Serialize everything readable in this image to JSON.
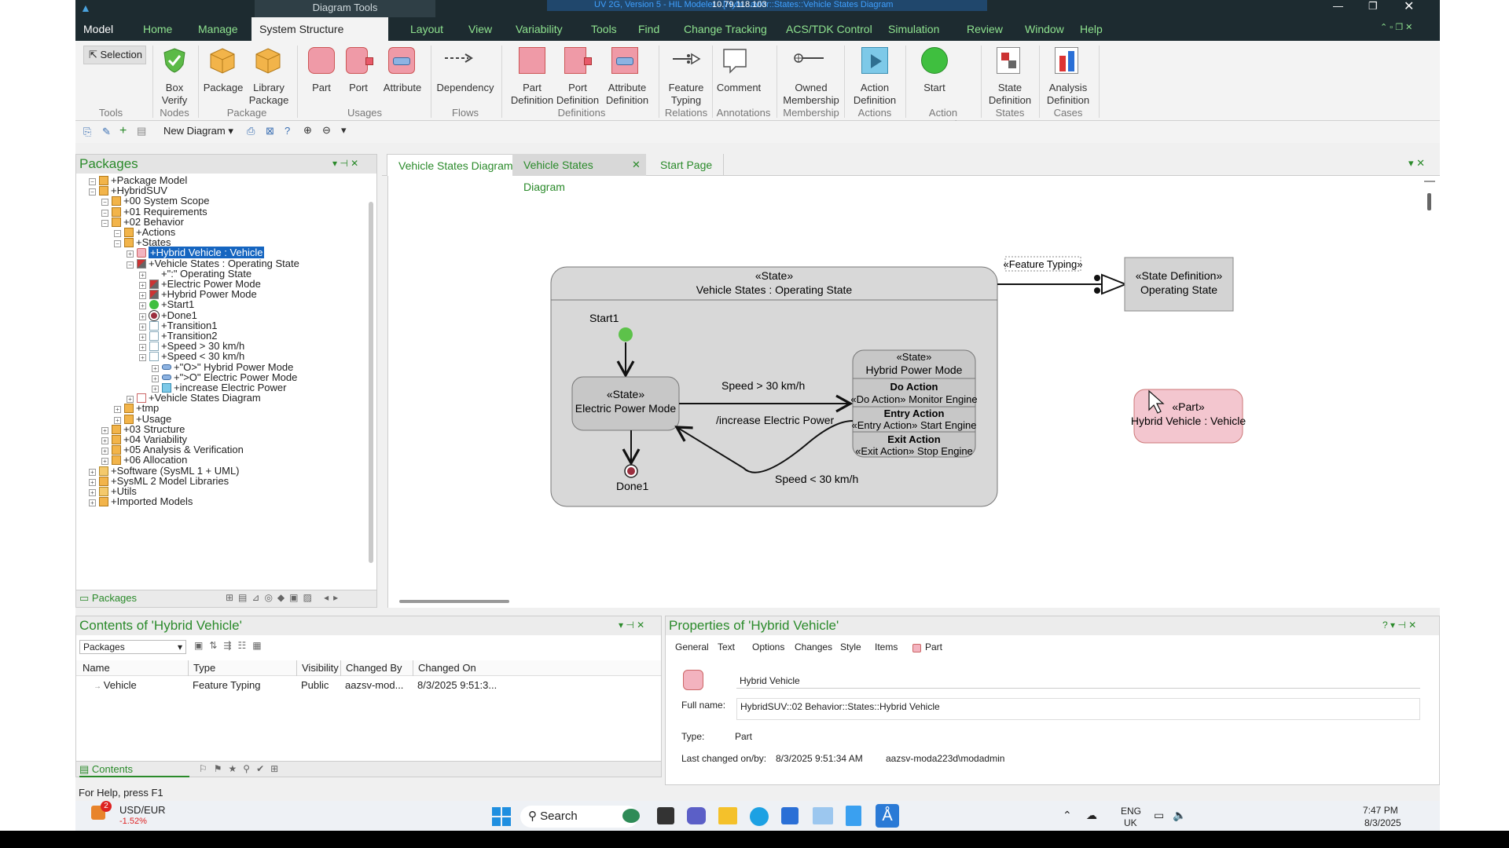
{
  "title_bar": {
    "context_label": "Diagram Tools",
    "ip": "10.79.118.103",
    "doc_title": "UV 2G, Version 5 - HIL Modeler - [Hybr...avior::States::Vehicle States Diagram"
  },
  "ribbon_tabs": [
    "Model",
    "Home",
    "Manage",
    "System Structure Diagram",
    "Layout",
    "View",
    "Variability",
    "Tools",
    "Find",
    "Change Tracking",
    "ACS/TDK Control",
    "Simulation",
    "Review",
    "Window",
    "Help"
  ],
  "ribbon": {
    "selection": "Selection",
    "buttons": [
      {
        "label": "Box\nVerify",
        "name": "box-verify"
      },
      {
        "label": "Package",
        "name": "package"
      },
      {
        "label": "Library\nPackage",
        "name": "library-package"
      },
      {
        "label": "Part",
        "name": "part"
      },
      {
        "label": "Port",
        "name": "port"
      },
      {
        "label": "Attribute",
        "name": "attribute"
      },
      {
        "label": "Dependency",
        "name": "dependency"
      },
      {
        "label": "Part\nDefinition",
        "name": "part-definition"
      },
      {
        "label": "Port\nDefinition",
        "name": "port-definition"
      },
      {
        "label": "Attribute\nDefinition",
        "name": "attribute-definition"
      },
      {
        "label": "Feature\nTyping",
        "name": "feature-typing"
      },
      {
        "label": "Comment",
        "name": "comment"
      },
      {
        "label": "Owned\nMembership",
        "name": "owned-membership"
      },
      {
        "label": "Action\nDefinition",
        "name": "action-definition"
      },
      {
        "label": "Start",
        "name": "start"
      },
      {
        "label": "State\nDefinition",
        "name": "state-definition"
      },
      {
        "label": "Analysis\nDefinition",
        "name": "analysis-definition"
      }
    ],
    "groups": [
      "Tools",
      "Nodes",
      "Package",
      "Usages",
      "Flows",
      "Definitions",
      "Relations",
      "Annotations",
      "Membership",
      "Actions",
      "Action Controls",
      "States",
      "Cases"
    ]
  },
  "toolbar2": {
    "new_diagram": "New Diagram"
  },
  "packages_panel": {
    "title": "Packages",
    "footer_tab": "Packages",
    "tree": [
      {
        "level": 1,
        "label": "+Package Model",
        "icon": "package"
      },
      {
        "level": 1,
        "label": "+HybridSUV",
        "icon": "package"
      },
      {
        "level": 2,
        "label": "+00 System Scope",
        "icon": "package"
      },
      {
        "level": 2,
        "label": "+01 Requirements",
        "icon": "package"
      },
      {
        "level": 2,
        "label": "+02 Behavior",
        "icon": "package"
      },
      {
        "level": 3,
        "label": "+Actions",
        "icon": "package"
      },
      {
        "level": 3,
        "label": "+States",
        "icon": "package"
      },
      {
        "level": 4,
        "label": "+Hybrid Vehicle : Vehicle",
        "icon": "part",
        "selected": true
      },
      {
        "level": 4,
        "label": "+Vehicle States : Operating State",
        "icon": "state"
      },
      {
        "level": 5,
        "label": "+\":\" Operating State",
        "icon": "typing"
      },
      {
        "level": 5,
        "label": "+Electric Power Mode",
        "icon": "state"
      },
      {
        "level": 5,
        "label": "+Hybrid Power Mode",
        "icon": "state"
      },
      {
        "level": 5,
        "label": "+Start1",
        "icon": "start"
      },
      {
        "level": 5,
        "label": "+Done1",
        "icon": "done"
      },
      {
        "level": 5,
        "label": "+Transition1",
        "icon": "transition"
      },
      {
        "level": 5,
        "label": "+Transition2",
        "icon": "transition"
      },
      {
        "level": 5,
        "label": "+Speed > 30 km/h",
        "icon": "transition"
      },
      {
        "level": 5,
        "label": "+Speed < 30 km/h",
        "icon": "transition"
      },
      {
        "level": 6,
        "label": "+\"O>\" Hybrid Power Mode",
        "icon": "member"
      },
      {
        "level": 6,
        "label": "+\">O\" Electric Power Mode",
        "icon": "member"
      },
      {
        "level": 6,
        "label": "+increase Electric Power",
        "icon": "action"
      },
      {
        "level": 4,
        "label": "+Vehicle States Diagram",
        "icon": "diagram"
      },
      {
        "level": 3,
        "label": "+tmp",
        "icon": "package"
      },
      {
        "level": 3,
        "label": "+Usage",
        "icon": "package"
      },
      {
        "level": 2,
        "label": "+03 Structure",
        "icon": "package"
      },
      {
        "level": 2,
        "label": "+04 Variability",
        "icon": "package"
      },
      {
        "level": 2,
        "label": "+05 Analysis & Verification",
        "icon": "package"
      },
      {
        "level": 2,
        "label": "+06 Allocation",
        "icon": "package"
      },
      {
        "level": 1,
        "label": "+Software (SysML 1 + UML)",
        "icon": "folder"
      },
      {
        "level": 1,
        "label": "+SysML 2 Model Libraries",
        "icon": "package"
      },
      {
        "level": 1,
        "label": "+Utils",
        "icon": "folder"
      },
      {
        "level": 1,
        "label": "+Imported Models",
        "icon": "package"
      }
    ]
  },
  "diagram_tabs": [
    "Vehicle States Diagram",
    "Vehicle States Diagram",
    "Start Page"
  ],
  "diagram": {
    "outer_state": {
      "stereotype": "«State»",
      "name": "Vehicle States : Operating State"
    },
    "feature_typing_label": "«Feature Typing»",
    "state_def": {
      "stereotype": "«State Definition»",
      "name": "Operating State"
    },
    "part": {
      "stereotype": "«Part»",
      "name": "Hybrid Vehicle : Vehicle"
    },
    "start_label": "Start1",
    "done_label": "Done1",
    "electric": {
      "stereotype": "«State»",
      "name": "Electric Power Mode"
    },
    "hybrid": {
      "stereotype": "«State»",
      "name": "Hybrid Power Mode",
      "do_title": "Do Action",
      "do_body": "«Do Action» Monitor Engine",
      "entry_title": "Entry Action",
      "entry_body": "«Entry Action» Start Engine",
      "exit_title": "Exit Action",
      "exit_body": "«Exit Action» Stop Engine"
    },
    "t_up": "Speed > 30 km/h",
    "t_effect": "/increase Electric Power",
    "t_down": "Speed < 30 km/h"
  },
  "contents_panel": {
    "title": "Contents of 'Hybrid Vehicle'",
    "filter": "Packages",
    "columns": [
      "Name",
      "Type",
      "Visibility",
      "Changed By",
      "Changed On"
    ],
    "rows": [
      [
        "Vehicle",
        "Feature Typing",
        "Public",
        "aazsv-mod...",
        "8/3/2025 9:51:3..."
      ]
    ],
    "footer_tab": "Contents"
  },
  "props_panel": {
    "title": "Properties of 'Hybrid Vehicle'",
    "tabs": [
      "General",
      "Text",
      "Options",
      "Changes",
      "Style",
      "Items",
      "Part"
    ],
    "name_value": "Hybrid Vehicle",
    "full_name_label": "Full name:",
    "full_name": "HybridSUV::02 Behavior::States::Hybrid Vehicle",
    "type_label": "Type:",
    "type_value": "Part",
    "changed_label": "Last changed on/by:",
    "changed_on": "8/3/2025 9:51:34 AM",
    "changed_by": "aazsv-moda223d\\modadmin"
  },
  "status": "For Help, press F1",
  "taskbar": {
    "ticker": "USD/EUR",
    "ticker_change": "-1.52%",
    "badge": "2",
    "search": "Search",
    "lang1": "ENG",
    "lang2": "UK",
    "time": "7:47 PM",
    "date": "8/3/2025"
  },
  "colors": {
    "accent_green": "#2a8a2a",
    "tab_green": "#8fe38f",
    "part_pink": "#f3c6cf",
    "state_gray": "#d3d3d3",
    "titlebar": "#1d2b30"
  }
}
